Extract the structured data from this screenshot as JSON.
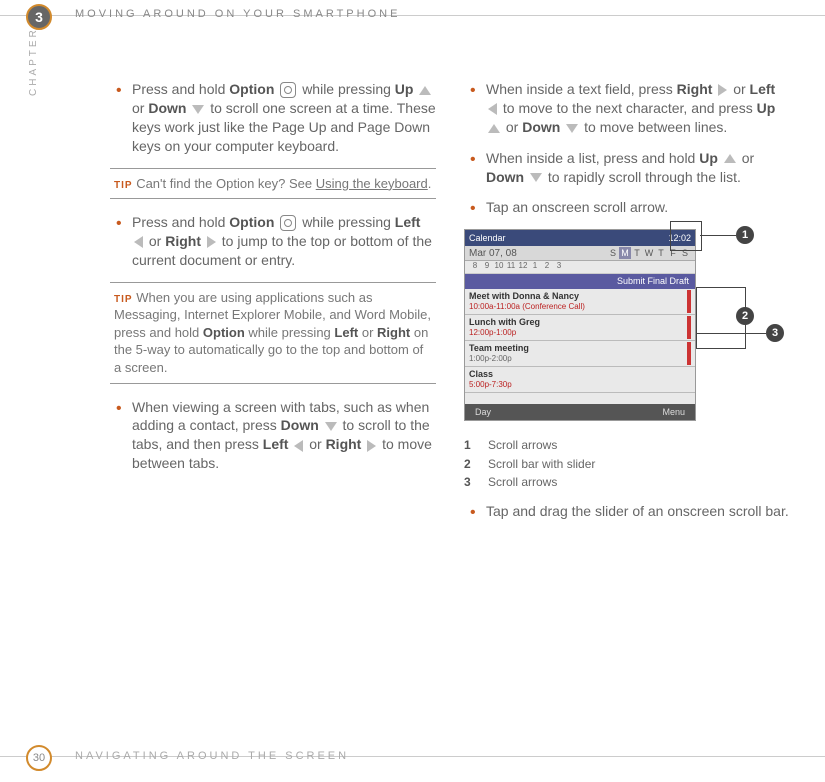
{
  "header": {
    "chapter_num": "3",
    "title": "MOVING AROUND ON YOUR SMARTPHONE"
  },
  "side_label": "CHAPTER",
  "left": {
    "bullet1": {
      "p1": "Press and hold ",
      "opt": "Option",
      "p2": " while pressing ",
      "up": "Up",
      "or": " or ",
      "down": "Down",
      "p3": " to scroll one screen at a time. These keys work just like the Page Up and Page Down keys on your computer keyboard."
    },
    "tip1": {
      "label": "TIP",
      "t1": "Can't find the Option key? See ",
      "link": "Using the keyboard",
      "t2": "."
    },
    "bullet2": {
      "p1": "Press and hold ",
      "opt": "Option",
      "p2": " while pressing ",
      "left": "Left",
      "or": " or ",
      "right": "Right",
      "p3": " to jump to the top or bottom of the current document or entry."
    },
    "tip2": {
      "label": "TIP",
      "text": "When you are using applications such as Messaging, Internet Explorer Mobile, and Word Mobile, press and hold ",
      "opt": "Option",
      "text2": " while pressing ",
      "l": "Left",
      "or": " or ",
      "r": "Right",
      "text3": " on the 5-way to automatically go to the top and bottom of a screen."
    },
    "bullet3": {
      "p1": "When viewing a screen with tabs, such as when adding a contact, press ",
      "down": "Down",
      "p2": " to scroll to the tabs, and then press ",
      "left": "Left",
      "or": " or ",
      "right": "Right",
      "p3": " to move between tabs."
    }
  },
  "right": {
    "bullet1": {
      "p1": "When inside a text field, press ",
      "right": "Right",
      "or": " or ",
      "left": "Left",
      "p2": " to move to the next character, and press ",
      "up": "Up",
      "or2": " or ",
      "down": "Down",
      "p3": " to move between lines."
    },
    "bullet2": {
      "p1": "When inside a list, press and hold ",
      "up": "Up",
      "or": " or ",
      "down": "Down",
      "p2": " to rapidly scroll through the list."
    },
    "bullet3": {
      "text": "Tap an onscreen scroll arrow."
    },
    "device": {
      "title": "Calendar",
      "time": "12:02",
      "date": "Mar 07, 08",
      "days": [
        "S",
        "M",
        "T",
        "W",
        "T",
        "F",
        "S"
      ],
      "nums": [
        "8",
        "9",
        "10",
        "11",
        "12",
        "1",
        "2",
        "3"
      ],
      "submit": "Submit Final Draft",
      "rows": [
        {
          "t1": "Meet with Donna & Nancy",
          "t2": "10:00a-11:00a (Conference Call)",
          "red": true
        },
        {
          "t1": "Lunch with Greg",
          "t2": "12:00p-1:00p",
          "red": true
        },
        {
          "t1": "Team meeting",
          "t2": "1:00p-2:00p",
          "red": false
        },
        {
          "t1": "Class",
          "t2": "5:00p-7:30p",
          "red": true
        }
      ],
      "bottom_left": "Day",
      "bottom_right": "Menu"
    },
    "callouts": {
      "c1": "1",
      "c2": "2",
      "c3": "3"
    },
    "legend": [
      {
        "n": "1",
        "t": "Scroll arrows"
      },
      {
        "n": "2",
        "t": "Scroll bar with slider"
      },
      {
        "n": "3",
        "t": "Scroll arrows"
      }
    ],
    "bullet4": {
      "text": "Tap and drag the slider of an onscreen scroll bar."
    }
  },
  "footer": {
    "page": "30",
    "title": "NAVIGATING AROUND THE SCREEN"
  }
}
